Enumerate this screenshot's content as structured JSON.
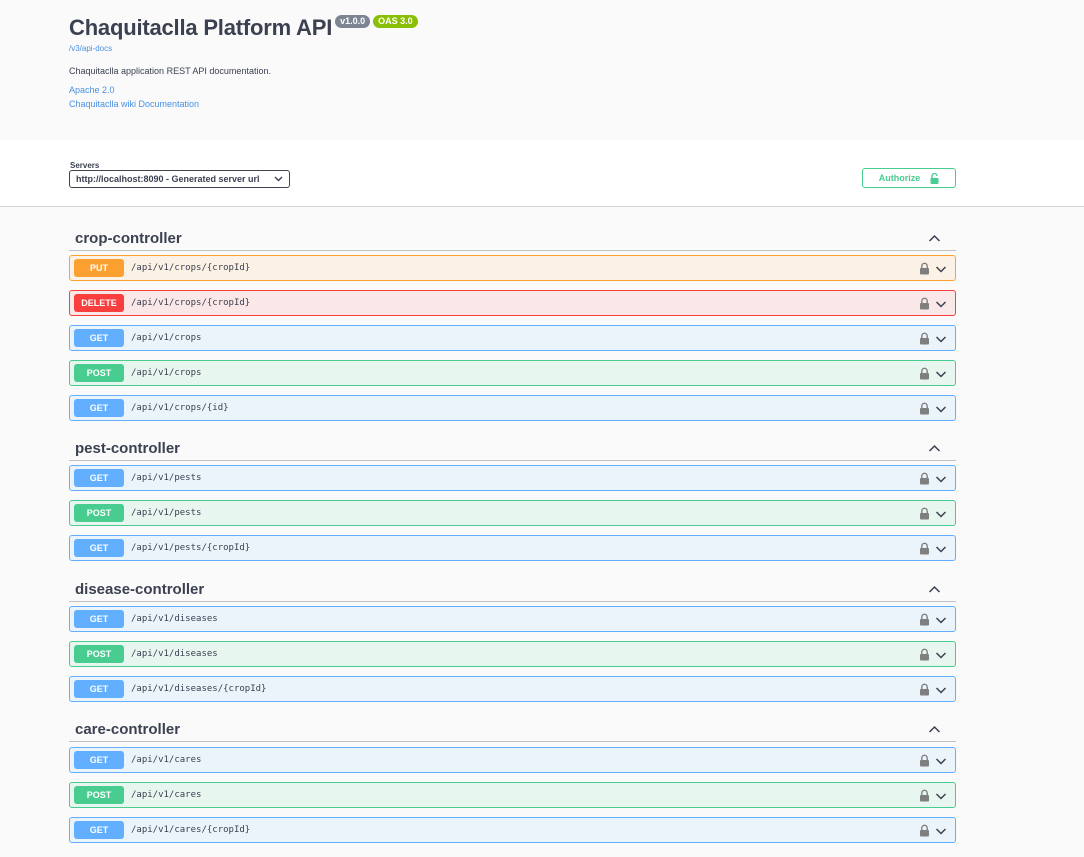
{
  "info": {
    "title": "Chaquitaclla Platform API",
    "version_badge": "v1.0.0",
    "oas_badge": "OAS 3.0",
    "url": "/v3/api-docs",
    "description": "Chaquitaclla application REST API documentation.",
    "license_link": "Apache 2.0",
    "wiki_link": "Chaquitaclla wiki Documentation"
  },
  "servers": {
    "label": "Servers",
    "selected": "http://localhost:8090 - Generated server url"
  },
  "authorize": {
    "label": "Authorize"
  },
  "colors": {
    "put": "#fca130",
    "delete": "#f93e3e",
    "get": "#61affe",
    "post": "#49cc90",
    "link": "#4990e2"
  },
  "sections": [
    {
      "name": "crop-controller",
      "ops": [
        {
          "method": "PUT",
          "path": "/api/v1/crops/{cropId}"
        },
        {
          "method": "DELETE",
          "path": "/api/v1/crops/{cropId}"
        },
        {
          "method": "GET",
          "path": "/api/v1/crops"
        },
        {
          "method": "POST",
          "path": "/api/v1/crops"
        },
        {
          "method": "GET",
          "path": "/api/v1/crops/{id}"
        }
      ]
    },
    {
      "name": "pest-controller",
      "ops": [
        {
          "method": "GET",
          "path": "/api/v1/pests"
        },
        {
          "method": "POST",
          "path": "/api/v1/pests"
        },
        {
          "method": "GET",
          "path": "/api/v1/pests/{cropId}"
        }
      ]
    },
    {
      "name": "disease-controller",
      "ops": [
        {
          "method": "GET",
          "path": "/api/v1/diseases"
        },
        {
          "method": "POST",
          "path": "/api/v1/diseases"
        },
        {
          "method": "GET",
          "path": "/api/v1/diseases/{cropId}"
        }
      ]
    },
    {
      "name": "care-controller",
      "ops": [
        {
          "method": "GET",
          "path": "/api/v1/cares"
        },
        {
          "method": "POST",
          "path": "/api/v1/cares"
        },
        {
          "method": "GET",
          "path": "/api/v1/cares/{cropId}"
        }
      ]
    }
  ]
}
